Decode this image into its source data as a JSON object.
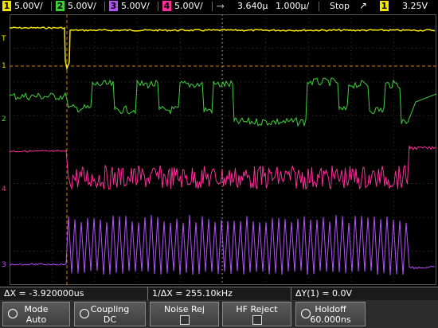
{
  "topbar": {
    "channels": [
      {
        "num": "1",
        "scale": "5.00V/",
        "color": "#f2e600"
      },
      {
        "num": "2",
        "scale": "5.00V/",
        "color": "#3ed13a"
      },
      {
        "num": "3",
        "scale": "5.00V/",
        "color": "#b650ff"
      },
      {
        "num": "4",
        "scale": "5.00V/",
        "color": "#ff2d9a"
      }
    ],
    "time_position": "3.640µ",
    "time_scale": "1.000µ/",
    "run_state": "Stop",
    "trigger_channel": "1",
    "trigger_level": "3.25V"
  },
  "markers": {
    "ch1_label": "1",
    "ch2_label": "2",
    "ch3_label": "3",
    "ch4_label": "4",
    "trigger_label": "T"
  },
  "measurements": {
    "delta_x": "ΔX = -3.920000us",
    "inv_delta_x": "1/ΔX = 255.10kHz",
    "delta_y": "ΔY(1) = 0.0V"
  },
  "softkeys": {
    "mode_label": "Mode",
    "mode_value": "Auto",
    "coupling_label": "Coupling",
    "coupling_value": "DC",
    "noise_rej_label": "Noise Rej",
    "hf_reject_label": "HF Reject",
    "holdoff_label": "Holdoff",
    "holdoff_value": "60.000ns"
  },
  "colors": {
    "ch1": "#f2e600",
    "ch2": "#3ed13a",
    "ch3": "#b650ff",
    "ch4": "#ff2d9a",
    "cursor": "#e07a00"
  }
}
